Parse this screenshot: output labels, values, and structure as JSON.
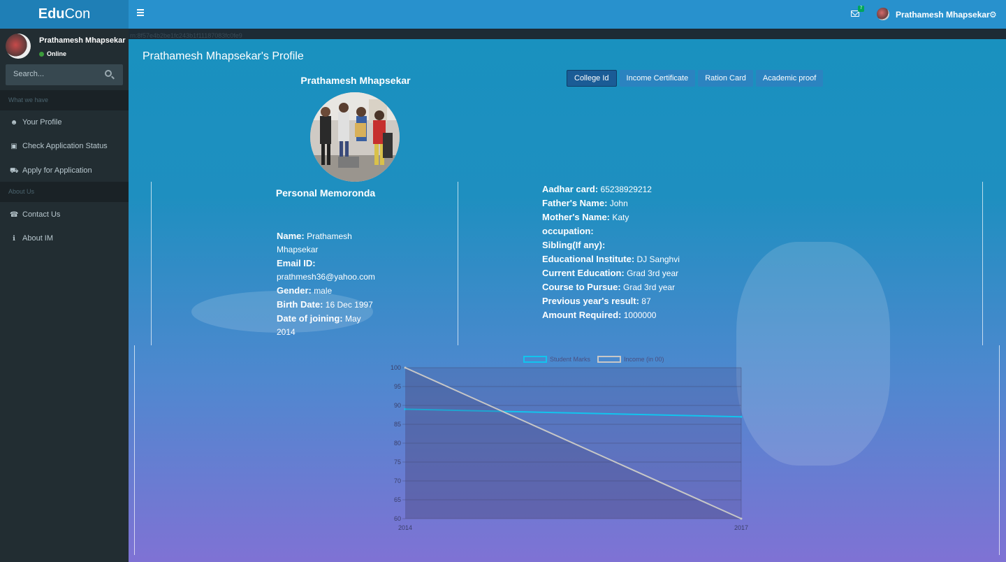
{
  "app": {
    "logo_strong": "Edu",
    "logo_rest": "Con"
  },
  "header": {
    "notification_count": "7",
    "user_name": "Prathamesh Mhapsekar",
    "colors": {
      "accent": "#2891cd",
      "logo_bg": "#1f7fb6"
    }
  },
  "sidebar": {
    "user_name": "Prathamesh Mhapsekar",
    "status": "Online",
    "search_placeholder": "Search...",
    "section_1": "What we have",
    "items_1": [
      {
        "label": "Your Profile",
        "icon": "user-icon"
      },
      {
        "label": "Check Application Status",
        "icon": "calendar-icon"
      },
      {
        "label": "Apply for Application",
        "icon": "cart-icon"
      }
    ],
    "section_2": "About Us",
    "items_2": [
      {
        "label": "Contact Us",
        "icon": "phone-icon"
      },
      {
        "label": "About IM",
        "icon": "info-icon"
      }
    ]
  },
  "main": {
    "title": "Prathamesh Mhapsekar's Profile",
    "tabs": [
      "College Id",
      "Income Certificate",
      "Ration Card",
      "Academic proof"
    ],
    "active_tab": "College Id",
    "profile_name": "Prathamesh Mhapsekar",
    "memo_title": "Personal Memoronda",
    "left_fields": [
      {
        "label": "Name:",
        "value": "Prathamesh Mhapsekar"
      },
      {
        "label": "Email ID:",
        "value": "prathmesh36@yahoo.com"
      },
      {
        "label": "Gender:",
        "value": "male"
      },
      {
        "label": "Birth Date:",
        "value": "16 Dec 1997"
      },
      {
        "label": "Date of joining:",
        "value": "May 2014"
      }
    ],
    "right_fields": [
      {
        "label": "Aadhar card:",
        "value": "65238929212"
      },
      {
        "label": "Father's Name:",
        "value": "John"
      },
      {
        "label": "Mother's Name:",
        "value": "Katy"
      },
      {
        "label": "occupation:",
        "value": ""
      },
      {
        "label": "Sibling(If any):",
        "value": ""
      },
      {
        "label": "Educational Institute:",
        "value": "DJ Sanghvi"
      },
      {
        "label": "Current Education:",
        "value": "Grad 3rd year"
      },
      {
        "label": "Course to Pursue:",
        "value": "Grad 3rd year"
      },
      {
        "label": "Previous year's result:",
        "value": "87"
      },
      {
        "label": "Amount Required:",
        "value": "1000000"
      }
    ]
  },
  "chart_data": {
    "type": "line",
    "x": [
      "2014",
      "2017"
    ],
    "series": [
      {
        "name": "Student Marks",
        "values": [
          89,
          87
        ],
        "color": "#12c4ee"
      },
      {
        "name": "Income (in 00)",
        "values": [
          100,
          60
        ],
        "color": "#c7c7c7"
      }
    ],
    "ylim": [
      60,
      100
    ],
    "yticks": [
      60,
      65,
      70,
      75,
      80,
      85,
      90,
      95,
      100
    ],
    "legend": "top",
    "grid": true
  }
}
